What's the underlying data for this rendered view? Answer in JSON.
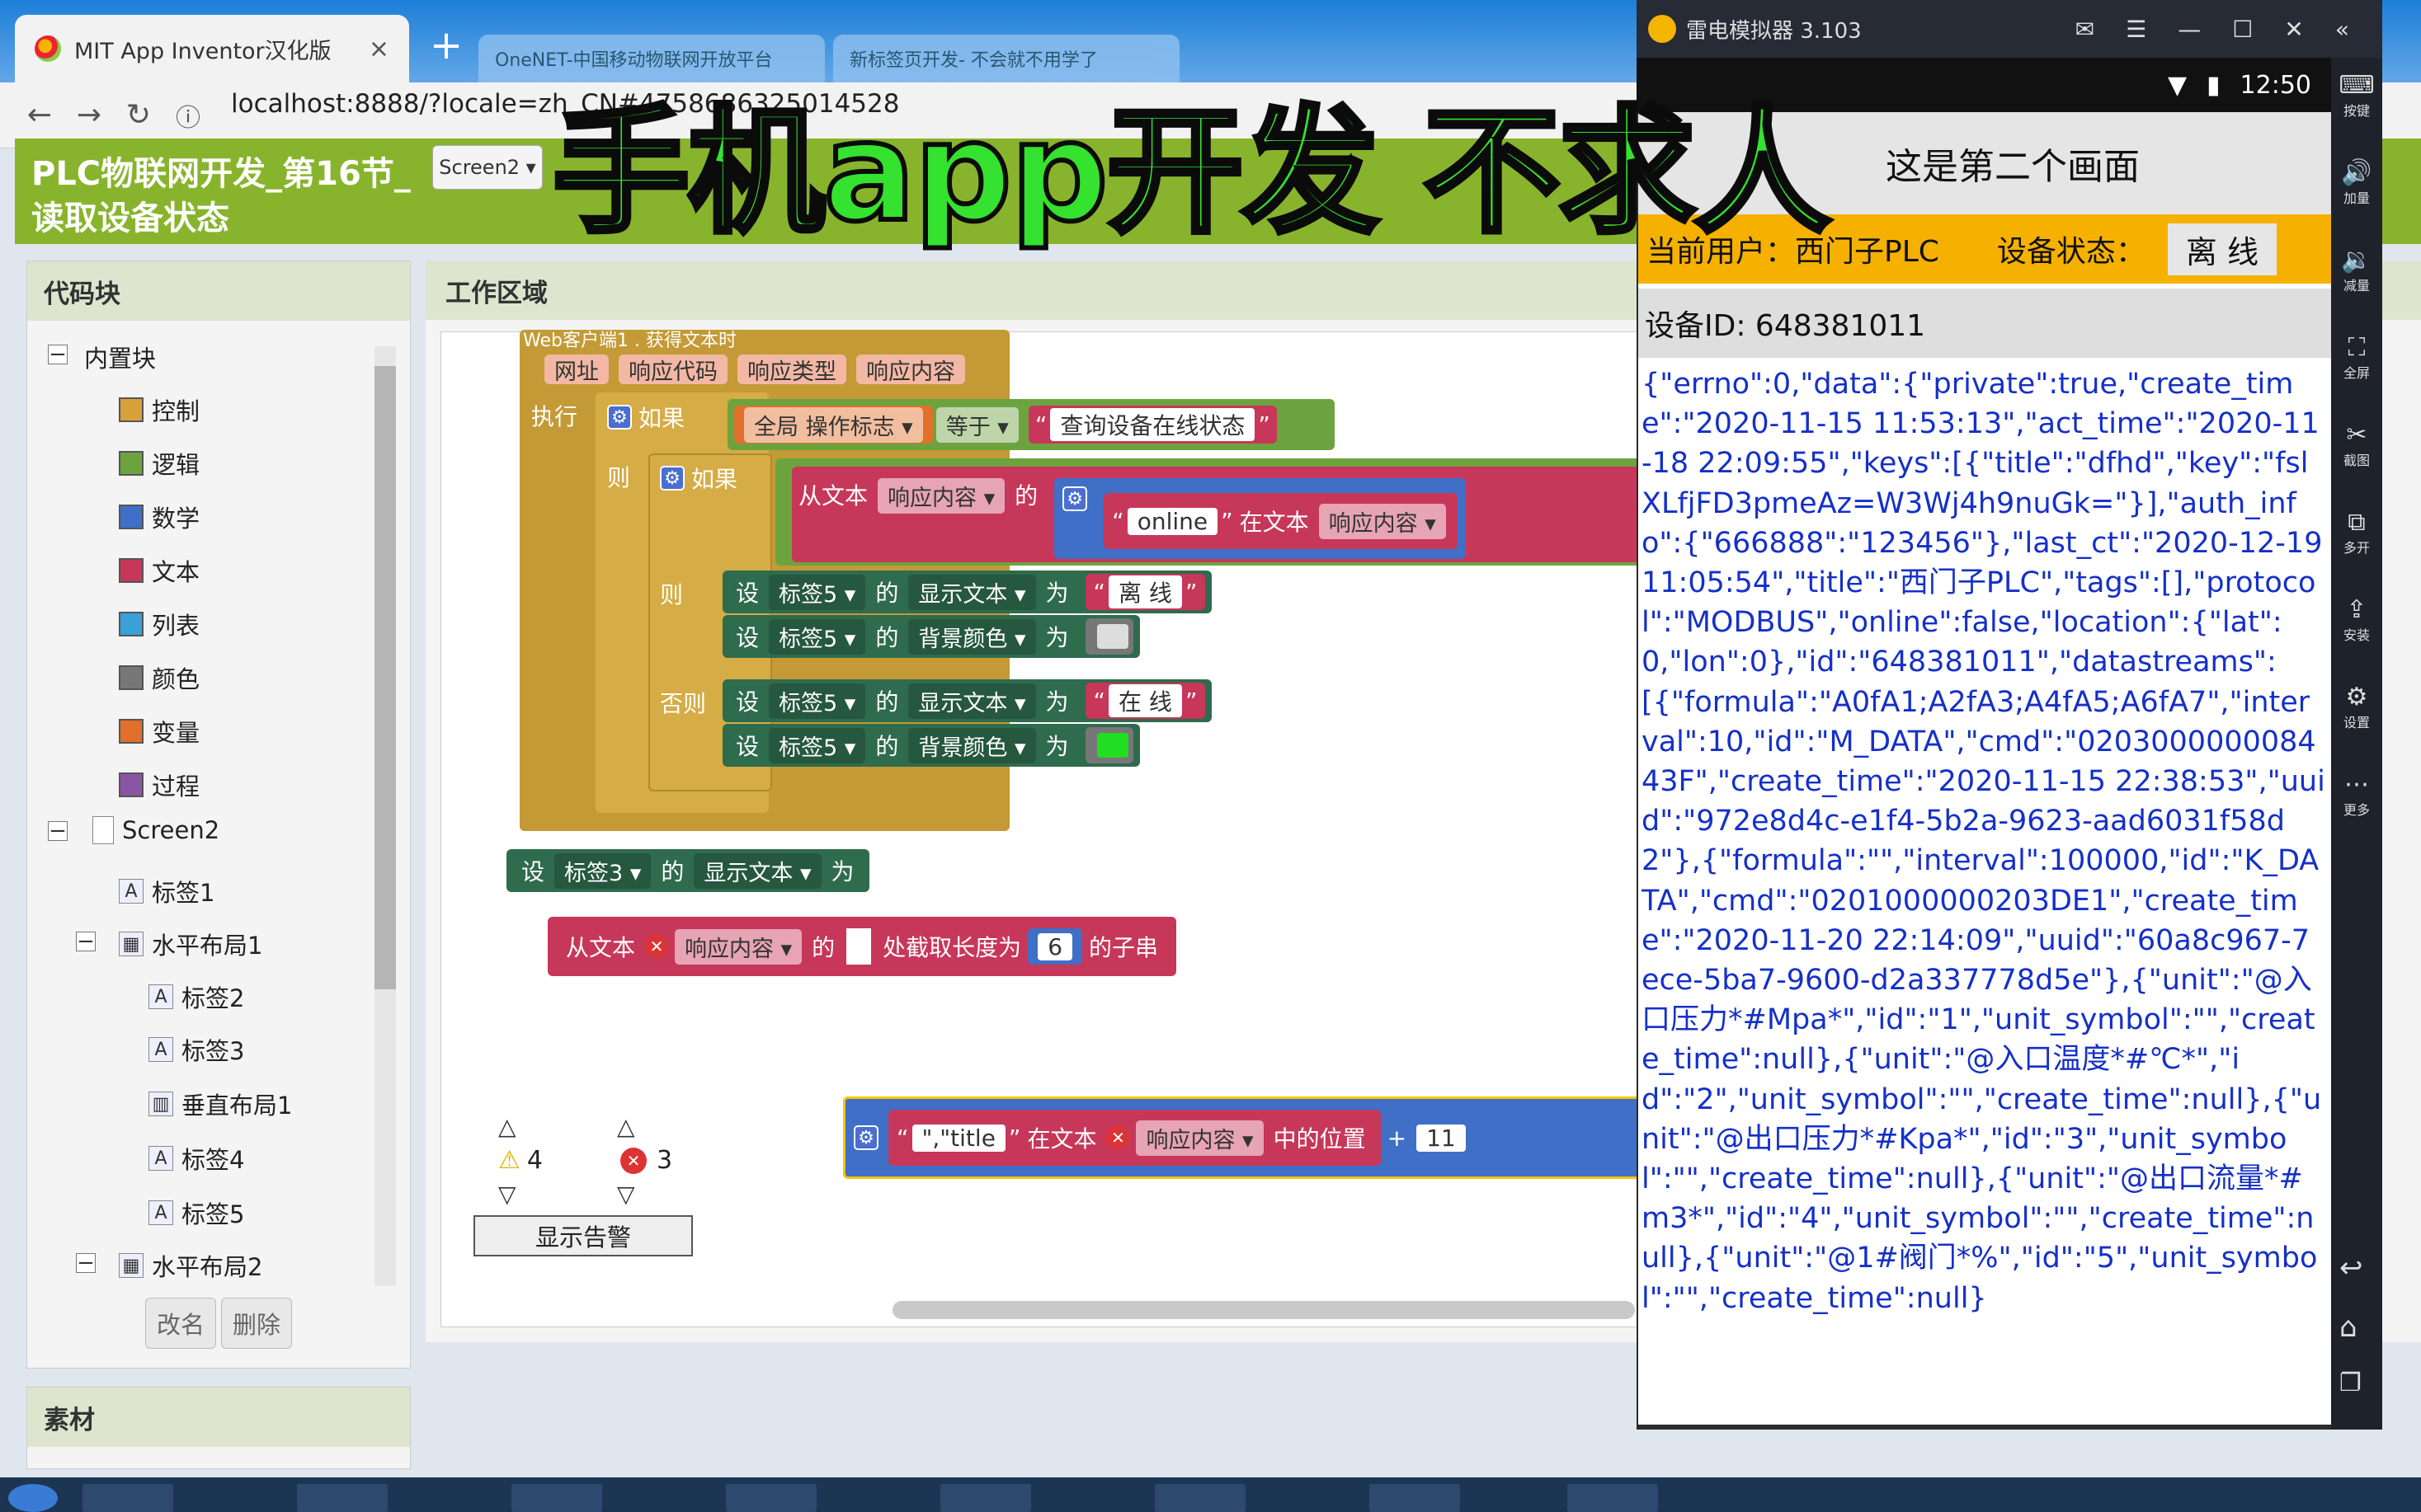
{
  "browser": {
    "tab1_title": "MIT App Inventor汉化版",
    "tab_close": "×",
    "new_tab": "+",
    "bg_tab1": "OneNET-中国移动物联网开放平台",
    "bg_tab2": "新标签页开发- 不会就不用学了",
    "url": "localhost:8888/?locale=zh_CN#4758686325014528",
    "back": "←",
    "forward": "→",
    "reload": "↻",
    "info": "ⓘ"
  },
  "overlay_title": "手机app开发 不求人",
  "app": {
    "project_title": "PLC物联网开发_第16节_读取设备状态",
    "screen_selector": "Screen2 ▾"
  },
  "left_panel": {
    "header": "代码块",
    "builtin": "内置块",
    "builtins": [
      {
        "label": "控制",
        "color": "#d9a13a"
      },
      {
        "label": "逻辑",
        "color": "#6da33f"
      },
      {
        "label": "数学",
        "color": "#3f6fc6"
      },
      {
        "label": "文本",
        "color": "#c7375a"
      },
      {
        "label": "列表",
        "color": "#3aa0d8"
      },
      {
        "label": "颜色",
        "color": "#777777"
      },
      {
        "label": "变量",
        "color": "#e0702a"
      },
      {
        "label": "过程",
        "color": "#8a55a4"
      }
    ],
    "screen": "Screen2",
    "components": [
      "标签1",
      "水平布局1",
      "标签2",
      "标签3",
      "垂直布局1",
      "标签4",
      "标签5",
      "水平布局2"
    ],
    "rename_btn": "改名",
    "delete_btn": "删除",
    "assets_header": "素材"
  },
  "workspace": {
    "header": "工作区域",
    "event_title": "Web客户端1 . 获得文本时",
    "params": [
      "网址",
      "响应代码",
      "响应类型",
      "响应内容"
    ],
    "exec": "执行",
    "if": "如果",
    "then": "则",
    "else": "否则",
    "global_flag": "全局 操作标志 ▾",
    "equals": "等于 ▾",
    "query_text": "查询设备在线状态",
    "from_text": "从文本",
    "resp_content": "响应内容 ▾",
    "of": "的",
    "online": "online",
    "in_text": "在文本",
    "set": "设",
    "label5": "标签5 ▾",
    "label3": "标签3 ▾",
    "display_text": "显示文本 ▾",
    "bg_color": "背景颜色 ▾",
    "to": "为",
    "offline": "离 线",
    "online_cn": "在 线",
    "substring_at": "处截取长度为",
    "num6": "6",
    "substring": "的子串",
    "title_str": "\",\"title",
    "position_of": "中的位置",
    "plus": "+",
    "num11": "11",
    "warnings_count": "4",
    "errors_count": "3",
    "show_warnings": "显示告警",
    "colors": {
      "event": "#b5892e",
      "control": "#c39a35",
      "text": "#c7375a",
      "setter": "#2f6b4d",
      "logic": "#6da33f",
      "math": "#3f6fc6",
      "offline_swatch": "#dddddd",
      "online_swatch": "#22dd22"
    }
  },
  "emulator": {
    "title": "雷电模拟器 3.103",
    "time": "12:50",
    "screen_title": "这是第二个画面",
    "user_label": "当前用户：西门子PLC",
    "device_status_label": "设备状态：",
    "device_status_value": "离 线",
    "device_id": "设备ID: 648381011",
    "json_text": "{\"errno\":0,\"data\":{\"private\":true,\"create_time\":\"2020-11-15 11:53:13\",\"act_time\":\"2020-11-18 22:09:55\",\"keys\":[{\"title\":\"dfhd\",\"key\":\"fslXLfjFD3pmeAz=W3Wj4h9nuGk=\"}],\"auth_info\":{\"666888\":\"123456\"},\"last_ct\":\"2020-12-19 11:05:54\",\"title\":\"西门子PLC\",\"tags\":[],\"protocol\":\"MODBUS\",\"online\":false,\"location\":{\"lat\":0,\"lon\":0},\"id\":\"648381011\",\"datastreams\":[{\"formula\":\"A0fA1;A2fA3;A4fA5;A6fA7\",\"interval\":10,\"id\":\"M_DATA\",\"cmd\":\"020300000008443F\",\"create_time\":\"2020-11-15 22:38:53\",\"uuid\":\"972e8d4c-e1f4-5b2a-9623-aad6031f58d2\"},{\"formula\":\"\",\"interval\":100000,\"id\":\"K_DATA\",\"cmd\":\"0201000000203DE1\",\"create_time\":\"2020-11-20 22:14:09\",\"uuid\":\"60a8c967-7ece-5ba7-9600-d2a337778d5e\"},{\"unit\":\"@入口压力*#Mpa*\",\"id\":\"1\",\"unit_symbol\":\"\",\"create_time\":null},{\"unit\":\"@入口温度*#℃*\",\"id\":\"2\",\"unit_symbol\":\"\",\"create_time\":null},{\"unit\":\"@出口压力*#Kpa*\",\"id\":\"3\",\"unit_symbol\":\"\",\"create_time\":null},{\"unit\":\"@出口流量*#m3*\",\"id\":\"4\",\"unit_symbol\":\"\",\"create_time\":null},{\"unit\":\"@1#阀门*%\",\"id\":\"5\",\"unit_symbol\":\"\",\"create_time\":null}",
    "sidebar": [
      {
        "icon": "⌨",
        "label": "按键"
      },
      {
        "icon": "🔊",
        "label": "加量"
      },
      {
        "icon": "🔉",
        "label": "减量"
      },
      {
        "icon": "⛶",
        "label": "全屏"
      },
      {
        "icon": "✂",
        "label": "截图"
      },
      {
        "icon": "⧉",
        "label": "多开"
      },
      {
        "icon": "⇪",
        "label": "安装"
      },
      {
        "icon": "⚙",
        "label": "设置"
      },
      {
        "icon": "⋯",
        "label": "更多"
      }
    ]
  }
}
